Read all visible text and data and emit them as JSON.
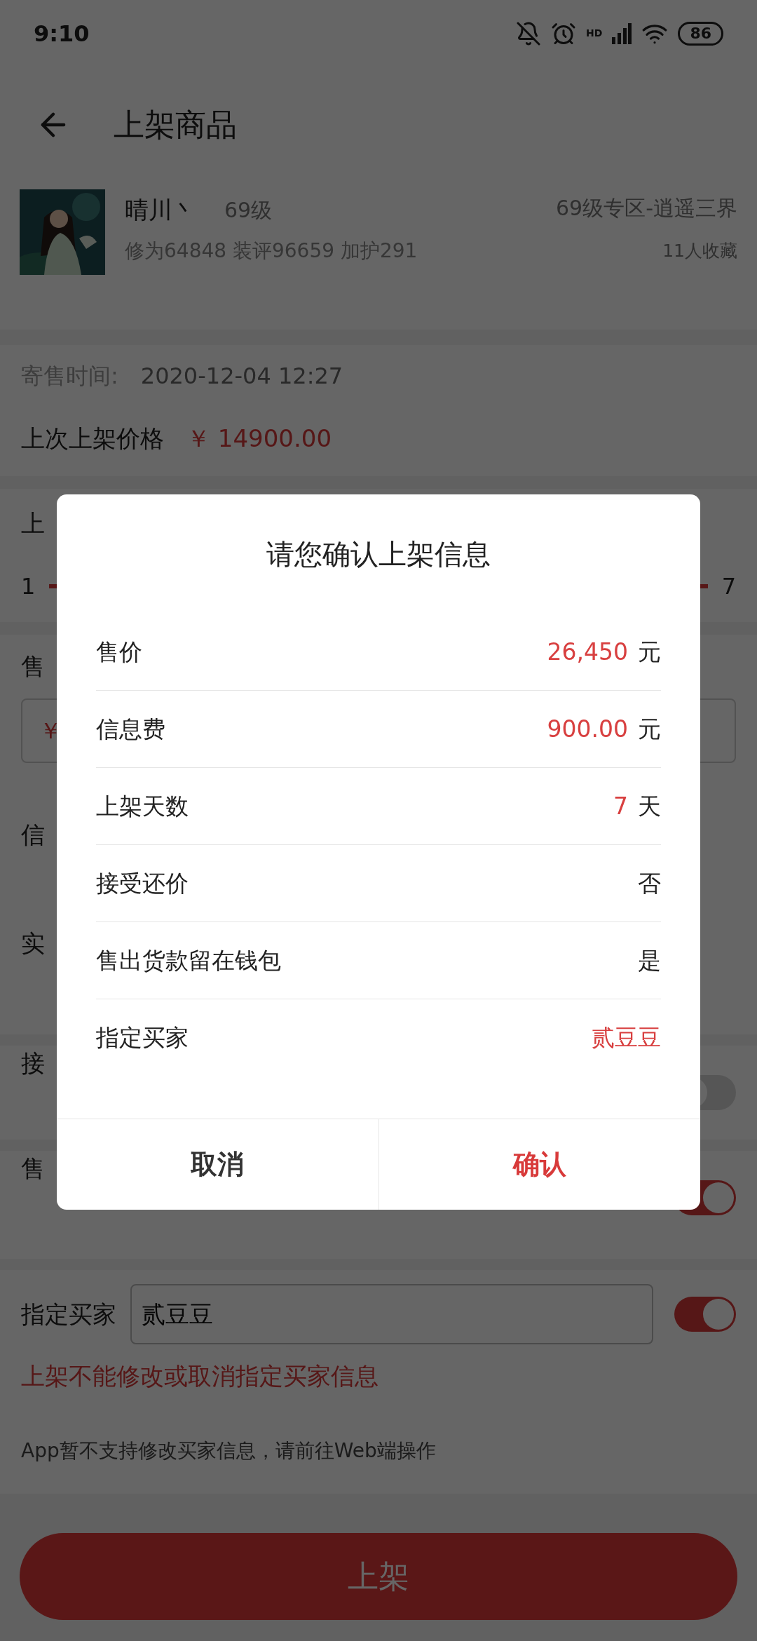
{
  "status_bar": {
    "time": "9:10",
    "network": "HD",
    "battery": "86"
  },
  "header": {
    "title": "上架商品"
  },
  "item": {
    "name": "晴川丶",
    "level": "69级",
    "stats": "修为64848 装评96659 加护291",
    "server": "69级专区-逍遥三界",
    "favorites": "11人收藏"
  },
  "info": [
    {
      "label": "寄售时间:",
      "value": "2020-12-04 12:27",
      "kind": "time"
    },
    {
      "label": "上次上架价格",
      "value": "￥ 14900.00",
      "kind": "price"
    }
  ],
  "days": {
    "label": "上",
    "min": "1",
    "max": "7",
    "level": 1
  },
  "form_rows": [
    {
      "label": "售",
      "kind": "price_field",
      "value": "￥"
    },
    {
      "label": "信",
      "kind": "text"
    },
    {
      "label": "实",
      "kind": "text"
    },
    {
      "label": "接",
      "kind": "toggle",
      "on": false
    },
    {
      "label": "售",
      "kind": "toggle",
      "on": true
    }
  ],
  "buyer": {
    "label": "指定买家",
    "value": "贰豆豆",
    "on": true,
    "warning": "上架不能修改或取消指定买家信息",
    "notice": "App暂不支持修改买家信息，请前往Web端操作"
  },
  "submit": "上架",
  "dialog": {
    "title": "请您确认上架信息",
    "rows": [
      {
        "label": "售价",
        "value": "26,450",
        "unit": "元",
        "highlight": true
      },
      {
        "label": "信息费",
        "value": "900.00",
        "unit": "元",
        "highlight": true
      },
      {
        "label": "上架天数",
        "value": "7",
        "unit": "天",
        "highlight": true
      },
      {
        "label": "接受还价",
        "value": "否",
        "highlight": false
      },
      {
        "label": "售出货款留在钱包",
        "value": "是",
        "highlight": false
      },
      {
        "label": "指定买家",
        "value": "贰豆豆",
        "highlight": true
      }
    ],
    "buttons": [
      {
        "label": "取消",
        "primary": false
      },
      {
        "label": "确认",
        "primary": true
      }
    ]
  }
}
